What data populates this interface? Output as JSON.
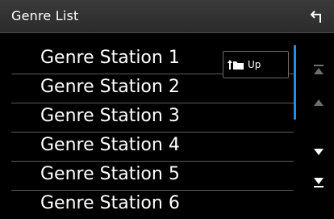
{
  "header": {
    "title": "Genre List",
    "back_icon": "back-arrow-icon"
  },
  "list": {
    "items": [
      {
        "label": "Genre Station 1"
      },
      {
        "label": "Genre Station 2"
      },
      {
        "label": "Genre Station 3"
      },
      {
        "label": "Genre Station 4"
      },
      {
        "label": "Genre Station 5"
      },
      {
        "label": "Genre Station 6"
      }
    ]
  },
  "up_button": {
    "label": "Up",
    "icon": "folder-up-icon"
  },
  "scroll": {
    "controls": [
      {
        "name": "scroll-to-top",
        "icon": "double-up-arrow-icon"
      },
      {
        "name": "scroll-up",
        "icon": "up-triangle-icon"
      },
      {
        "name": "scroll-down",
        "icon": "down-triangle-icon"
      },
      {
        "name": "scroll-to-bottom",
        "icon": "double-down-arrow-icon"
      }
    ]
  },
  "colors": {
    "header_bg": "#2f2f2f",
    "scrollbar": "#2f8ad8",
    "background": "#000000",
    "text": "#ffffff",
    "disabled_icon": "#6e6e6e"
  }
}
